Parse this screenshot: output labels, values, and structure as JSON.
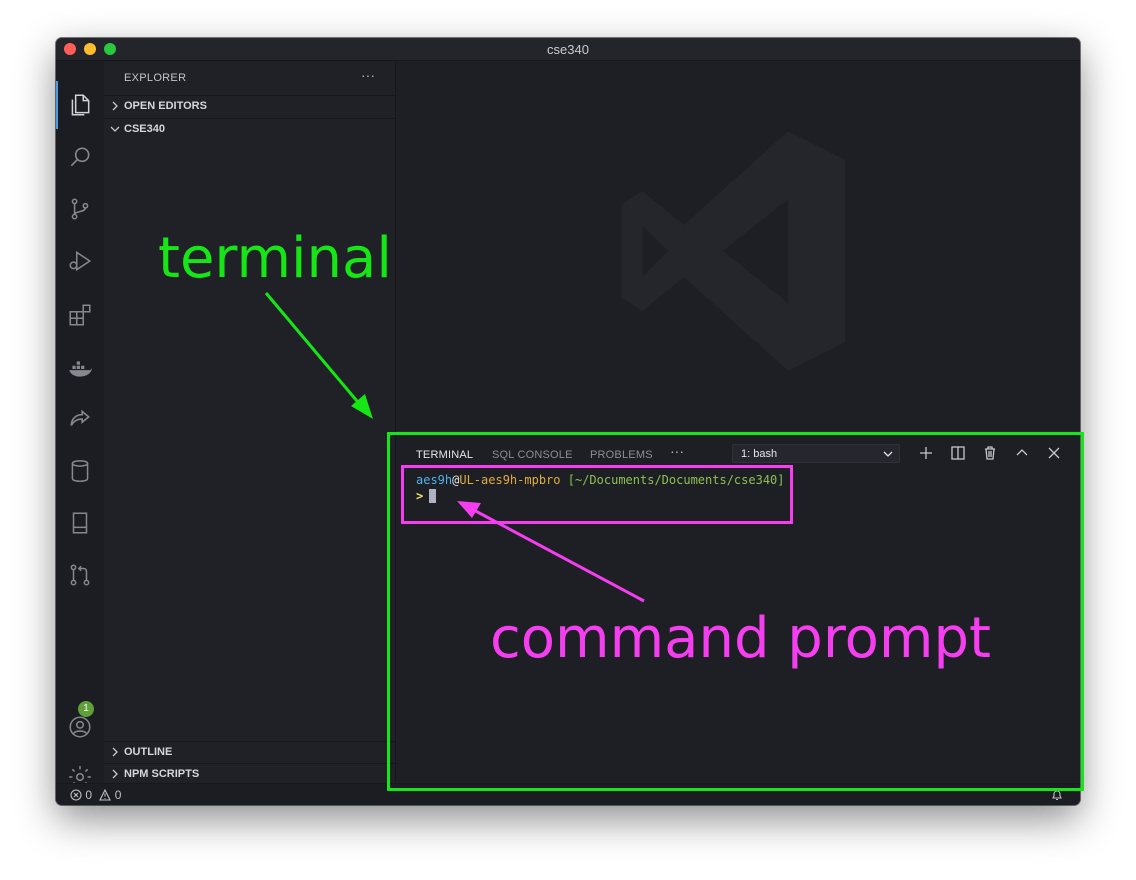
{
  "window": {
    "title": "cse340"
  },
  "sidebar": {
    "title": "EXPLORER",
    "more": "···",
    "sections": [
      {
        "label": "OPEN EDITORS"
      },
      {
        "label": "CSE340"
      },
      {
        "label": "OUTLINE"
      },
      {
        "label": "NPM SCRIPTS"
      }
    ]
  },
  "activitybar": {
    "icons": [
      "files-icon",
      "search-icon",
      "source-control-icon",
      "run-debug-icon",
      "extensions-icon",
      "docker-icon",
      "live-share-icon",
      "database-icon",
      "book-icon",
      "pull-request-icon",
      "account-icon",
      "gear-icon"
    ],
    "account_badge": "1"
  },
  "panel": {
    "tabs": [
      {
        "label": "TERMINAL",
        "active": true
      },
      {
        "label": "SQL CONSOLE",
        "active": false
      },
      {
        "label": "PROBLEMS",
        "active": false
      }
    ],
    "more": "···",
    "terminal_select": "1: bash",
    "actions": [
      "plus-icon",
      "split-icon",
      "trash-icon",
      "chevron-up-icon",
      "close-icon"
    ]
  },
  "terminal": {
    "user": "aes9h",
    "at": "@",
    "host": "UL-aes9h-mpbro",
    "path": "[~/Documents/Documents/cse340]",
    "prompt": ">"
  },
  "statusbar": {
    "errors": "0",
    "warnings": "0"
  },
  "annotations": {
    "terminal_label": "terminal",
    "prompt_label": "command prompt",
    "terminal_color": "#16e616",
    "prompt_color": "#f43ef0"
  },
  "colors": {
    "editor_bg": "#1e1f25",
    "sidebar_bg": "#202127",
    "activitybar_bg": "#1c1d22",
    "accent": "#4a9ae8"
  }
}
